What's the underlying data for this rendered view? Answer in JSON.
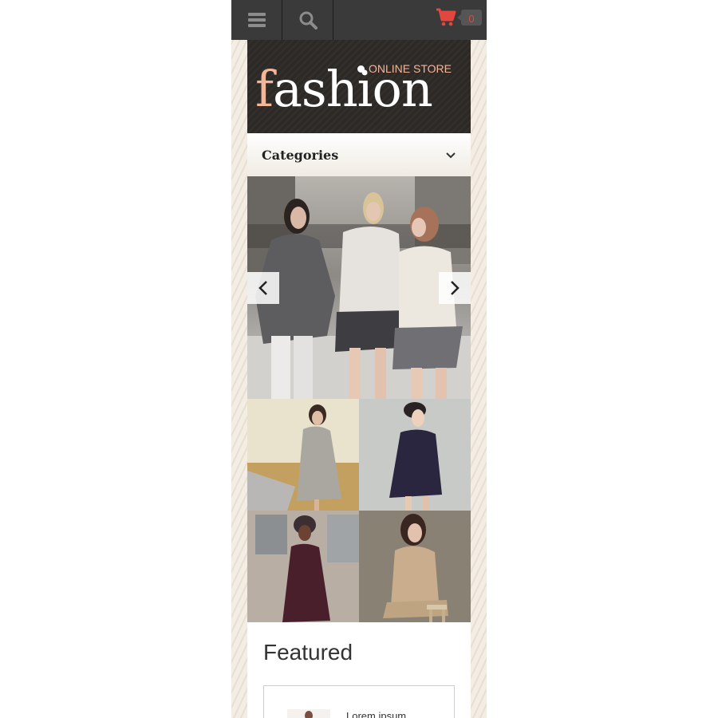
{
  "topbar": {
    "menu_icon": "hamburger-icon",
    "search_icon": "search-icon",
    "cart_icon": "cart-icon",
    "cart_count": "0",
    "cart_color": "#e2463c",
    "bar_color": "#3a3a3a"
  },
  "logo": {
    "first_letter": "f",
    "rest": "ashion",
    "tagline": "ONLINE STORE",
    "accent_color": "#f2b69b"
  },
  "categories": {
    "label": "Categories",
    "toggle_icon": "chevron-down-icon"
  },
  "slider": {
    "prev_icon": "chevron-left-icon",
    "next_icon": "chevron-right-icon"
  },
  "featured": {
    "title": "Featured",
    "products": [
      {
        "name": "Lorem ipsum"
      }
    ]
  }
}
